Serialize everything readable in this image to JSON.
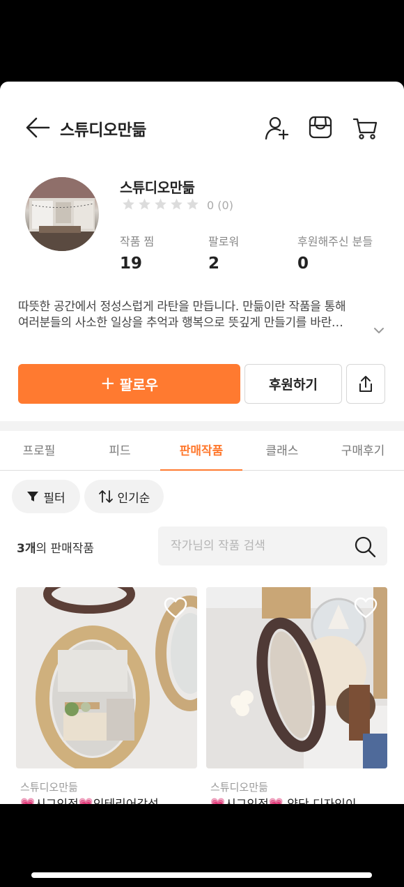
{
  "header": {
    "title": "스튜디오만듦"
  },
  "profile": {
    "name": "스튜디오만듦",
    "rating_count_text": "0  (0)",
    "stats": [
      {
        "label": "작품 찜",
        "value": "19"
      },
      {
        "label": "팔로워",
        "value": "2"
      },
      {
        "label": "후원해주신 분들",
        "value": "0"
      }
    ],
    "bio_line1": "따뜻한 공간에서 정성스럽게 라탄을 만듭니다. 만듦이란 작품을 통해",
    "bio_line2": "여러분들의 사소한 일상을 추억과 행복으로 뜻깊게 만들기를 바란…"
  },
  "actions": {
    "follow_plus": "+",
    "follow_label": "팔로우",
    "support_label": "후원하기"
  },
  "tabs": [
    {
      "label": "프로필"
    },
    {
      "label": "피드"
    },
    {
      "label": "판매작품"
    },
    {
      "label": "클래스"
    },
    {
      "label": "구매후기"
    }
  ],
  "filters": {
    "filter_label": "필터",
    "sort_label": "인기순"
  },
  "listing": {
    "count_number": "3개",
    "count_suffix": "의 판매작품",
    "search_placeholder": "작가님의 작품 검색"
  },
  "products": [
    {
      "shop": "스튜디오만듦",
      "title": "💗시그인정💗인테리어감성"
    },
    {
      "shop": "스튜디오만듦",
      "title": "💗시그인정💗 약단 디자인이"
    }
  ],
  "colors": {
    "accent": "#ff7a30",
    "background": "#ffffff",
    "chip_bg": "#f2f2f2"
  }
}
